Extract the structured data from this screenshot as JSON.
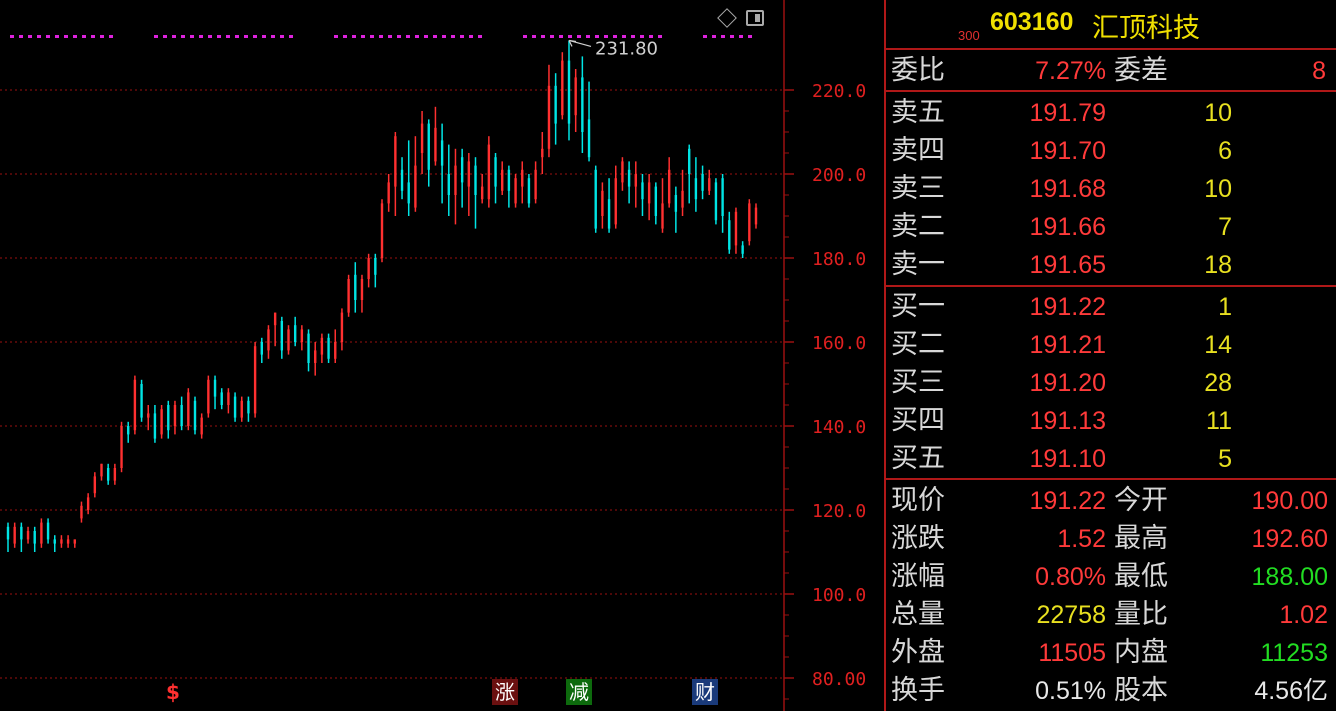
{
  "chart_data": {
    "type": "candlestick",
    "yticks": [
      "220.0",
      "200.0",
      "180.0",
      "160.0",
      "140.0",
      "120.0",
      "100.0",
      "80.00"
    ],
    "ylim": [
      75.5,
      239.5
    ],
    "peak_label": "231.80",
    "peak_value": 231.8,
    "candles": [
      {
        "o": 116,
        "c": 113,
        "h": 117,
        "l": 110
      },
      {
        "o": 112,
        "c": 116,
        "h": 117,
        "l": 111
      },
      {
        "o": 116,
        "c": 113,
        "h": 117,
        "l": 110
      },
      {
        "o": 113,
        "c": 115,
        "h": 116,
        "l": 112
      },
      {
        "o": 115,
        "c": 112,
        "h": 116,
        "l": 110
      },
      {
        "o": 112,
        "c": 117,
        "h": 118,
        "l": 111
      },
      {
        "o": 117,
        "c": 113,
        "h": 118,
        "l": 112
      },
      {
        "o": 113,
        "c": 112,
        "h": 114,
        "l": 110
      },
      {
        "o": 112,
        "c": 113,
        "h": 114,
        "l": 111
      },
      {
        "o": 112,
        "c": 113,
        "h": 114,
        "l": 111
      },
      {
        "o": 112,
        "c": 113,
        "h": 113,
        "l": 111
      },
      {
        "o": 118,
        "c": 121,
        "h": 122,
        "l": 117
      },
      {
        "o": 120,
        "c": 123,
        "h": 124,
        "l": 119
      },
      {
        "o": 124,
        "c": 128,
        "h": 129,
        "l": 123
      },
      {
        "o": 128,
        "c": 131,
        "h": 131,
        "l": 127
      },
      {
        "o": 130,
        "c": 127,
        "h": 131,
        "l": 126
      },
      {
        "o": 127,
        "c": 130,
        "h": 131,
        "l": 126
      },
      {
        "o": 130,
        "c": 140,
        "h": 141,
        "l": 129
      },
      {
        "o": 140,
        "c": 138,
        "h": 141,
        "l": 136
      },
      {
        "o": 139,
        "c": 151,
        "h": 152,
        "l": 138
      },
      {
        "o": 150,
        "c": 142,
        "h": 151,
        "l": 141
      },
      {
        "o": 142,
        "c": 143,
        "h": 145,
        "l": 139
      },
      {
        "o": 143,
        "c": 137,
        "h": 145,
        "l": 136
      },
      {
        "o": 138,
        "c": 144,
        "h": 145,
        "l": 137
      },
      {
        "o": 145,
        "c": 139,
        "h": 146,
        "l": 137
      },
      {
        "o": 140,
        "c": 145,
        "h": 146,
        "l": 138
      },
      {
        "o": 145,
        "c": 140,
        "h": 147,
        "l": 139
      },
      {
        "o": 140,
        "c": 148,
        "h": 149,
        "l": 139
      },
      {
        "o": 146,
        "c": 139,
        "h": 147,
        "l": 138
      },
      {
        "o": 138,
        "c": 142,
        "h": 143,
        "l": 137
      },
      {
        "o": 143,
        "c": 151,
        "h": 152,
        "l": 142
      },
      {
        "o": 151,
        "c": 147,
        "h": 152,
        "l": 144
      },
      {
        "o": 148,
        "c": 145,
        "h": 149,
        "l": 144
      },
      {
        "o": 145,
        "c": 148,
        "h": 149,
        "l": 143
      },
      {
        "o": 147,
        "c": 142,
        "h": 148,
        "l": 141
      },
      {
        "o": 142,
        "c": 146,
        "h": 147,
        "l": 141
      },
      {
        "o": 146,
        "c": 143,
        "h": 147,
        "l": 141
      },
      {
        "o": 143,
        "c": 159,
        "h": 160,
        "l": 142
      },
      {
        "o": 160,
        "c": 157,
        "h": 161,
        "l": 155
      },
      {
        "o": 158,
        "c": 163,
        "h": 164,
        "l": 156
      },
      {
        "o": 164,
        "c": 167,
        "h": 167,
        "l": 159
      },
      {
        "o": 165,
        "c": 158,
        "h": 166,
        "l": 156
      },
      {
        "o": 158,
        "c": 163,
        "h": 164,
        "l": 157
      },
      {
        "o": 164,
        "c": 160,
        "h": 166,
        "l": 159
      },
      {
        "o": 160,
        "c": 163,
        "h": 164,
        "l": 158
      },
      {
        "o": 162,
        "c": 155,
        "h": 163,
        "l": 153
      },
      {
        "o": 155,
        "c": 158,
        "h": 160,
        "l": 152
      },
      {
        "o": 157,
        "c": 161,
        "h": 162,
        "l": 155
      },
      {
        "o": 161,
        "c": 156,
        "h": 162,
        "l": 155
      },
      {
        "o": 156,
        "c": 160,
        "h": 163,
        "l": 155
      },
      {
        "o": 160,
        "c": 167,
        "h": 168,
        "l": 158
      },
      {
        "o": 167,
        "c": 175,
        "h": 176,
        "l": 166
      },
      {
        "o": 176,
        "c": 170,
        "h": 179,
        "l": 167
      },
      {
        "o": 170,
        "c": 175,
        "h": 176,
        "l": 167
      },
      {
        "o": 175,
        "c": 180,
        "h": 181,
        "l": 173
      },
      {
        "o": 180,
        "c": 176,
        "h": 181,
        "l": 173
      },
      {
        "o": 180,
        "c": 193,
        "h": 194,
        "l": 179
      },
      {
        "o": 193,
        "c": 198,
        "h": 200,
        "l": 191
      },
      {
        "o": 197,
        "c": 209,
        "h": 210,
        "l": 190
      },
      {
        "o": 201,
        "c": 196,
        "h": 204,
        "l": 194
      },
      {
        "o": 198,
        "c": 193,
        "h": 208,
        "l": 190
      },
      {
        "o": 192,
        "c": 202,
        "h": 209,
        "l": 191
      },
      {
        "o": 205,
        "c": 212,
        "h": 215,
        "l": 200
      },
      {
        "o": 212,
        "c": 201,
        "h": 213,
        "l": 197
      },
      {
        "o": 203,
        "c": 211,
        "h": 216,
        "l": 202
      },
      {
        "o": 208,
        "c": 202,
        "h": 212,
        "l": 193
      },
      {
        "o": 200,
        "c": 195,
        "h": 207,
        "l": 190
      },
      {
        "o": 195,
        "c": 202,
        "h": 206,
        "l": 188
      },
      {
        "o": 204,
        "c": 198,
        "h": 206,
        "l": 192
      },
      {
        "o": 197,
        "c": 203,
        "h": 205,
        "l": 190
      },
      {
        "o": 202,
        "c": 195,
        "h": 204,
        "l": 187
      },
      {
        "o": 194,
        "c": 197,
        "h": 200,
        "l": 193
      },
      {
        "o": 194,
        "c": 207,
        "h": 209,
        "l": 192
      },
      {
        "o": 204,
        "c": 197,
        "h": 205,
        "l": 193
      },
      {
        "o": 196,
        "c": 201,
        "h": 203,
        "l": 195
      },
      {
        "o": 201,
        "c": 196,
        "h": 202,
        "l": 192
      },
      {
        "o": 193,
        "c": 199,
        "h": 200,
        "l": 192
      },
      {
        "o": 197,
        "c": 201,
        "h": 203,
        "l": 193
      },
      {
        "o": 199,
        "c": 193,
        "h": 200,
        "l": 192
      },
      {
        "o": 194,
        "c": 201,
        "h": 203,
        "l": 193
      },
      {
        "o": 204,
        "c": 206,
        "h": 210,
        "l": 200
      },
      {
        "o": 206,
        "c": 221,
        "h": 226,
        "l": 204
      },
      {
        "o": 221,
        "c": 212,
        "h": 224,
        "l": 207
      },
      {
        "o": 214,
        "c": 227,
        "h": 229,
        "l": 213
      },
      {
        "o": 227,
        "c": 212,
        "h": 231.8,
        "l": 208
      },
      {
        "o": 214,
        "c": 223,
        "h": 225,
        "l": 210
      },
      {
        "o": 223,
        "c": 210,
        "h": 228,
        "l": 205
      },
      {
        "o": 213,
        "c": 204,
        "h": 222,
        "l": 203
      },
      {
        "o": 201,
        "c": 187,
        "h": 202,
        "l": 186
      },
      {
        "o": 190,
        "c": 196,
        "h": 198,
        "l": 187
      },
      {
        "o": 194,
        "c": 187,
        "h": 199,
        "l": 186
      },
      {
        "o": 188,
        "c": 199,
        "h": 202,
        "l": 187
      },
      {
        "o": 198,
        "c": 203,
        "h": 204,
        "l": 196
      },
      {
        "o": 201,
        "c": 197,
        "h": 203,
        "l": 193
      },
      {
        "o": 197,
        "c": 200,
        "h": 203,
        "l": 192
      },
      {
        "o": 198,
        "c": 194,
        "h": 200,
        "l": 190
      },
      {
        "o": 193,
        "c": 198,
        "h": 200,
        "l": 189
      },
      {
        "o": 197,
        "c": 190,
        "h": 198,
        "l": 188
      },
      {
        "o": 187,
        "c": 193,
        "h": 199,
        "l": 186
      },
      {
        "o": 193,
        "c": 201,
        "h": 204,
        "l": 192
      },
      {
        "o": 195,
        "c": 191,
        "h": 197,
        "l": 186
      },
      {
        "o": 192,
        "c": 196,
        "h": 201,
        "l": 190
      },
      {
        "o": 206,
        "c": 200,
        "h": 207,
        "l": 193
      },
      {
        "o": 199,
        "c": 194,
        "h": 204,
        "l": 191
      },
      {
        "o": 200,
        "c": 196,
        "h": 202,
        "l": 194
      },
      {
        "o": 196,
        "c": 199,
        "h": 201,
        "l": 195
      },
      {
        "o": 198,
        "c": 189,
        "h": 199,
        "l": 188
      },
      {
        "o": 199,
        "c": 190,
        "h": 200,
        "l": 186
      },
      {
        "o": 189,
        "c": 182,
        "h": 191,
        "l": 181
      },
      {
        "o": 183,
        "c": 191,
        "h": 192,
        "l": 181
      },
      {
        "o": 183,
        "c": 181,
        "h": 184,
        "l": 180
      },
      {
        "o": 184,
        "c": 193,
        "h": 194,
        "l": 183
      },
      {
        "o": 188,
        "c": 192,
        "h": 193,
        "l": 187
      }
    ],
    "colors": {
      "up": "#ff3030",
      "down": "#00e5e5",
      "grid": "#9a1010",
      "marker": "#dd22dd"
    }
  },
  "icons": {
    "diamond": "diamond-icon",
    "panel": "panel-toggle-icon"
  },
  "events": {
    "s": "$",
    "zhang": "涨",
    "jian": "减",
    "cai": "财"
  },
  "stock": {
    "badge": "300",
    "code": "603160",
    "name": "汇顶科技"
  },
  "summary": {
    "weibi_label": "委比",
    "weibi": "7.27%",
    "weicha_label": "委差",
    "weicha": "8"
  },
  "sells": [
    {
      "label": "卖五",
      "price": "191.79",
      "vol": "10"
    },
    {
      "label": "卖四",
      "price": "191.70",
      "vol": "6"
    },
    {
      "label": "卖三",
      "price": "191.68",
      "vol": "10"
    },
    {
      "label": "卖二",
      "price": "191.66",
      "vol": "7"
    },
    {
      "label": "卖一",
      "price": "191.65",
      "vol": "18"
    }
  ],
  "buys": [
    {
      "label": "买一",
      "price": "191.22",
      "vol": "1"
    },
    {
      "label": "买二",
      "price": "191.21",
      "vol": "14"
    },
    {
      "label": "买三",
      "price": "191.20",
      "vol": "28"
    },
    {
      "label": "买四",
      "price": "191.13",
      "vol": "11"
    },
    {
      "label": "买五",
      "price": "191.10",
      "vol": "5"
    }
  ],
  "stats": [
    {
      "l1": "现价",
      "v1": "191.22",
      "c1": "red",
      "l2": "今开",
      "v2": "190.00",
      "c2": "red"
    },
    {
      "l1": "涨跌",
      "v1": "1.52",
      "c1": "red",
      "l2": "最高",
      "v2": "192.60",
      "c2": "red"
    },
    {
      "l1": "涨幅",
      "v1": "0.80%",
      "c1": "red",
      "l2": "最低",
      "v2": "188.00",
      "c2": "green"
    },
    {
      "l1": "总量",
      "v1": "22758",
      "c1": "yellow",
      "l2": "量比",
      "v2": "1.02",
      "c2": "red"
    },
    {
      "l1": "外盘",
      "v1": "11505",
      "c1": "red",
      "l2": "内盘",
      "v2": "11253",
      "c2": "green"
    },
    {
      "l1": "换手",
      "v1": "0.51%",
      "c1": "white",
      "l2": "股本",
      "v2": "4.56亿",
      "c2": "white"
    }
  ]
}
